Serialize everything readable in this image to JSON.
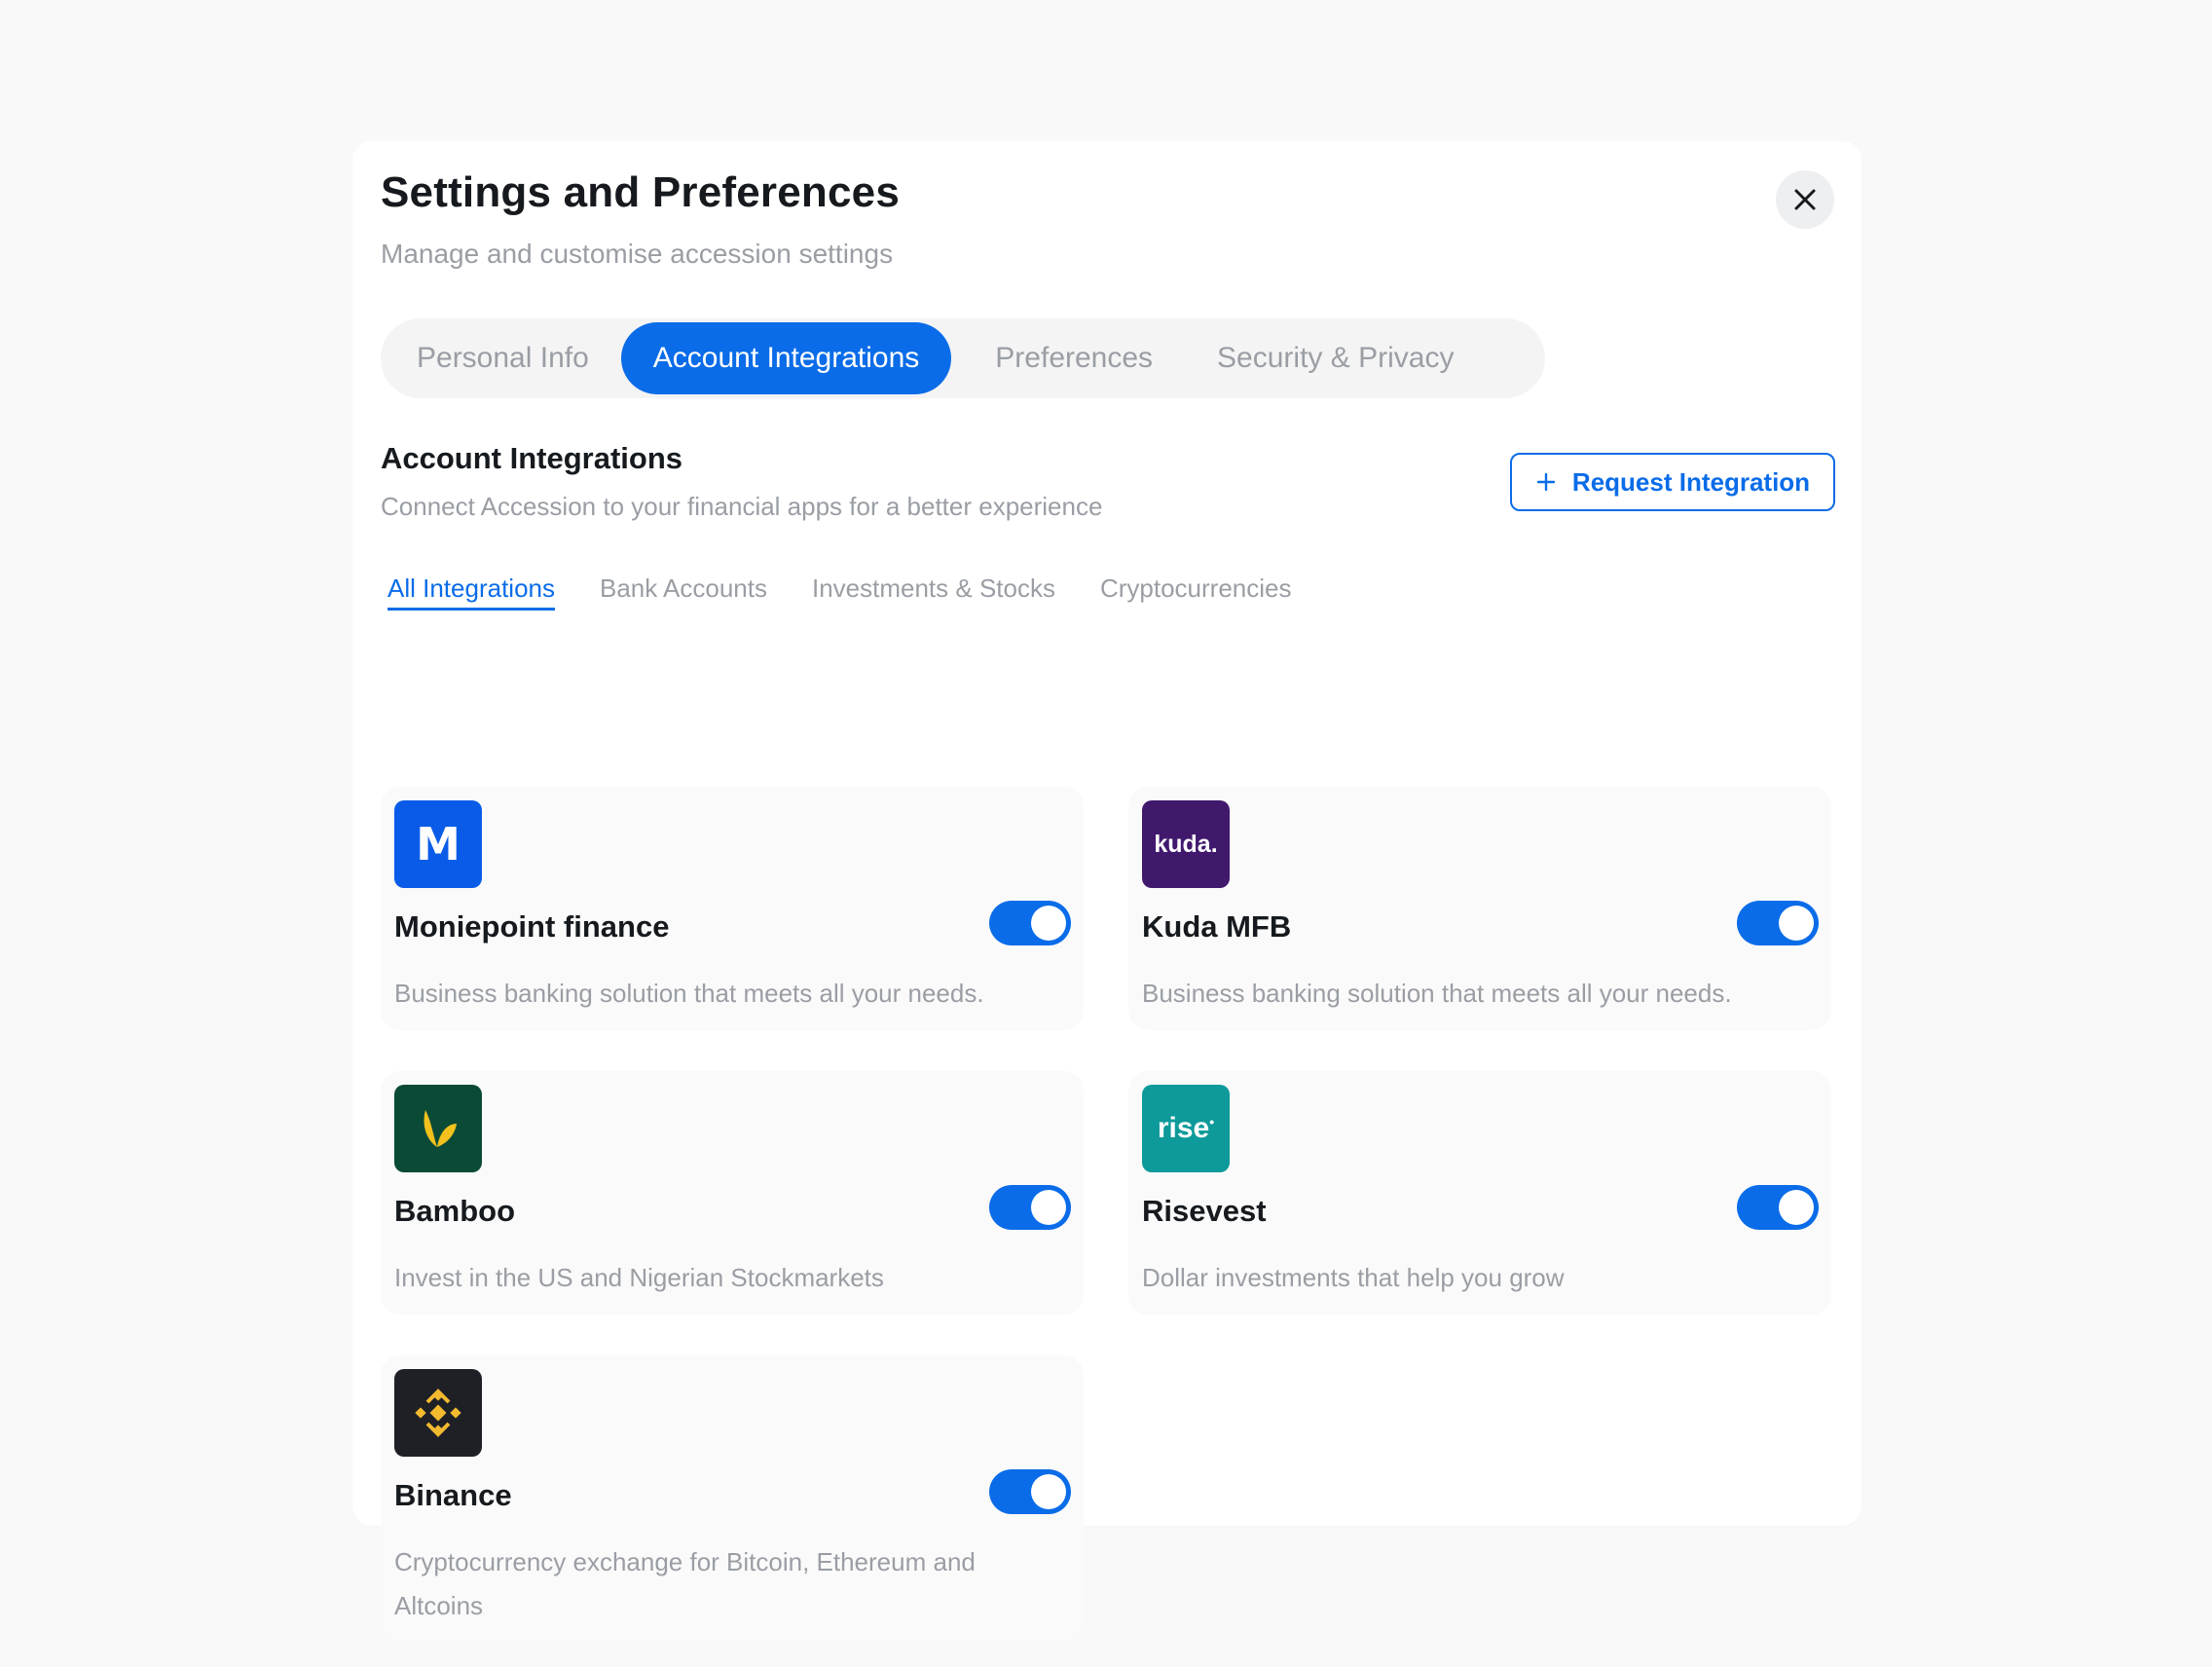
{
  "header": {
    "title": "Settings and Preferences",
    "subtitle": "Manage and customise accession settings",
    "close_icon": "close-icon"
  },
  "tabs": [
    {
      "label": "Personal Info",
      "active": false
    },
    {
      "label": "Account Integrations",
      "active": true
    },
    {
      "label": "Preferences",
      "active": false
    },
    {
      "label": "Security & Privacy",
      "active": false
    }
  ],
  "section": {
    "title": "Account Integrations",
    "subtitle": "Connect Accession to your financial apps for a better experience",
    "request_button": "Request Integration",
    "request_icon": "plus-icon"
  },
  "subtabs": [
    {
      "label": "All Integrations",
      "active": true
    },
    {
      "label": "Bank Accounts",
      "active": false
    },
    {
      "label": "Investments & Stocks",
      "active": false
    },
    {
      "label": "Cryptocurrencies",
      "active": false
    }
  ],
  "integrations": [
    {
      "name": "Moniepoint finance",
      "description": "Business banking solution that meets all your needs.",
      "enabled": true,
      "logo": "moniepoint-logo",
      "logo_text": "M",
      "logo_color": "#0a5ce8"
    },
    {
      "name": "Kuda MFB",
      "description": "Business banking solution that meets all your needs.",
      "enabled": true,
      "logo": "kuda-logo",
      "logo_text": "kuda.",
      "logo_color": "#40196d"
    },
    {
      "name": "Bamboo",
      "description": "Invest in the US and Nigerian Stockmarkets",
      "enabled": true,
      "logo": "bamboo-logo",
      "logo_color": "#0b4a36"
    },
    {
      "name": "Risevest",
      "description": "Dollar investments that help you grow",
      "enabled": true,
      "logo": "rise-logo",
      "logo_text": "rise",
      "logo_color": "#0e9a9a"
    },
    {
      "name": "Binance",
      "description": "Cryptocurrency exchange for Bitcoin, Ethereum and Altcoins",
      "enabled": true,
      "logo": "binance-logo",
      "logo_color": "#1e2026"
    }
  ],
  "colors": {
    "accent": "#0a6ce8",
    "muted_text": "#9a9ea4",
    "card_bg": "#fafafa"
  }
}
